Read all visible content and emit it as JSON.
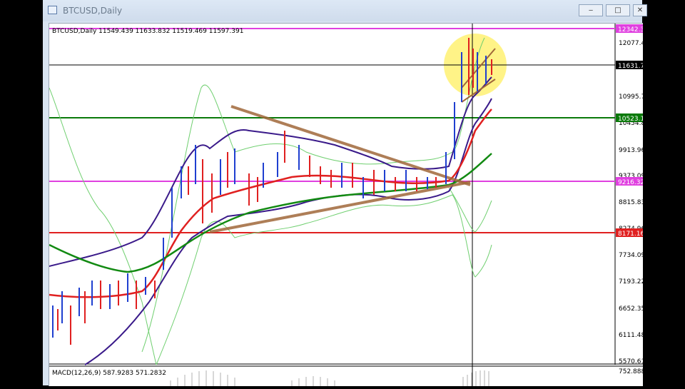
{
  "window": {
    "title": "BTCUSD,Daily",
    "controls": {
      "minimize": "‒",
      "maximize": "□",
      "close": "✕"
    }
  },
  "main_chart": {
    "symbol_line": "BTCUSD,Daily  11549.439 11633.832 11519.469 11597.391",
    "price_axis": [
      "12077.4",
      "10995.7",
      "9913.96",
      "9373.09",
      "8815.83",
      "7734.09",
      "7193.22",
      "6652.35",
      "6111.48",
      "5570.61"
    ],
    "price_axis_partial": [
      "10454.8",
      "8274.96"
    ],
    "level_labels": [
      {
        "name": "upper-resistance",
        "text": "12342.3",
        "color": "#e040e0"
      },
      {
        "name": "current-price",
        "text": "11631.7",
        "color": "#000000"
      },
      {
        "name": "resistance-green",
        "text": "10523.1",
        "color": "#0a7a0a"
      },
      {
        "name": "pivot-magenta",
        "text": "9216.32",
        "color": "#e040e0"
      },
      {
        "name": "support-red",
        "text": "8171.16",
        "color": "#e02020"
      }
    ]
  },
  "macd_panel": {
    "label": "MACD(12,26,9) 587.9283 571.2832",
    "axis_value": "752.888"
  },
  "colors": {
    "bull_candle": "#1f3fd0",
    "bear_candle": "#e02020",
    "ma_fast": "#e02020",
    "ma_slow": "#128a12",
    "bollinger": "#3a1a8a",
    "envelope": "#6fcf6f",
    "trendline": "#a0683a",
    "highlight": "#fff27a"
  }
}
